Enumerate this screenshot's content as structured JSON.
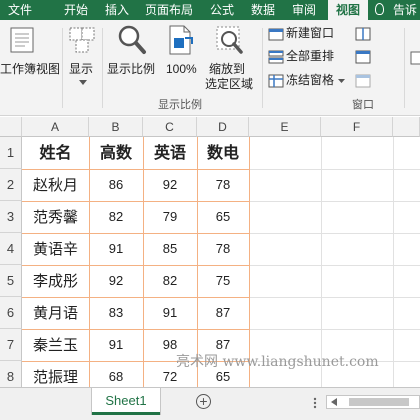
{
  "ribbon_tabs": [
    "文件",
    "开始",
    "插入",
    "页面布局",
    "公式",
    "数据",
    "审阅",
    "视图",
    "告诉"
  ],
  "active_tab": "视图",
  "ribbon": {
    "workbook_views_label": "工作簿视图",
    "show_label": "显示",
    "zoom_label": "显示比例",
    "zoom_100_label": "100%",
    "zoom_selection_label_line1": "缩放到",
    "zoom_selection_label_line2": "选定区域",
    "zoom_group_label": "显示比例",
    "new_window_label": "新建窗口",
    "arrange_all_label": "全部重排",
    "freeze_panes_label": "冻结窗格",
    "window_group_label": "窗口"
  },
  "columns": [
    "A",
    "B",
    "C",
    "D",
    "E",
    "F"
  ],
  "row_numbers": [
    "1",
    "2",
    "3",
    "4",
    "5",
    "6",
    "7",
    "8"
  ],
  "table": {
    "headers": [
      "姓名",
      "高数",
      "英语",
      "数电"
    ],
    "rows": [
      [
        "赵秋月",
        "86",
        "92",
        "78"
      ],
      [
        "范秀馨",
        "82",
        "79",
        "65"
      ],
      [
        "黄语辛",
        "91",
        "85",
        "78"
      ],
      [
        "李成彤",
        "92",
        "82",
        "75"
      ],
      [
        "黄月语",
        "83",
        "91",
        "87"
      ],
      [
        "秦兰玉",
        "91",
        "98",
        "87"
      ],
      [
        "范振理",
        "68",
        "72",
        "65"
      ]
    ]
  },
  "watermark": "亮术网 www.liangshunet.com",
  "sheet_tab": "Sheet1",
  "add_sheet_symbol": "+",
  "colors": {
    "accent": "#217346",
    "data_border": "#f4b183"
  },
  "icons": [
    "lightbulb-icon",
    "workbook-views-icon",
    "show-icon",
    "zoom-icon",
    "zoom-100-icon",
    "zoom-to-selection-icon",
    "new-window-icon",
    "arrange-all-icon",
    "freeze-panes-icon",
    "split-icon",
    "hide-icon",
    "unhide-icon"
  ]
}
